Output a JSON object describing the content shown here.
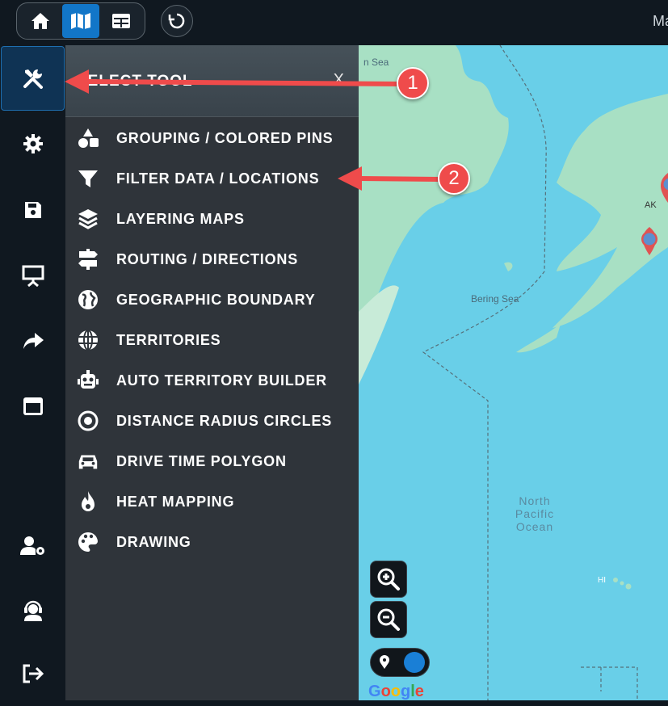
{
  "topbar": {
    "buttons": [
      {
        "name": "home",
        "icon": "home-icon",
        "active": false
      },
      {
        "name": "map",
        "icon": "map-icon",
        "active": true
      },
      {
        "name": "table",
        "icon": "table-icon",
        "active": false
      }
    ],
    "refresh_icon": "refresh-icon",
    "right_text": "Ma"
  },
  "rail": {
    "items": [
      {
        "icon": "tools-icon",
        "active": true
      },
      {
        "icon": "gear-icon"
      },
      {
        "icon": "save-icon"
      },
      {
        "icon": "presentation-icon"
      },
      {
        "icon": "share-icon"
      },
      {
        "icon": "window-icon"
      },
      {
        "icon": "user-settings-icon"
      },
      {
        "icon": "support-icon"
      },
      {
        "icon": "logout-icon"
      }
    ]
  },
  "panel": {
    "title": "SELECT TOOL",
    "close": "X",
    "tools": [
      {
        "label": "GROUPING / COLORED PINS",
        "icon": "shapes-icon"
      },
      {
        "label": "FILTER DATA / LOCATIONS",
        "icon": "filter-icon"
      },
      {
        "label": "LAYERING MAPS",
        "icon": "layers-icon"
      },
      {
        "label": "ROUTING / DIRECTIONS",
        "icon": "signpost-icon"
      },
      {
        "label": "GEOGRAPHIC BOUNDARY",
        "icon": "globe-icon"
      },
      {
        "label": "TERRITORIES",
        "icon": "grid-globe-icon"
      },
      {
        "label": "AUTO TERRITORY BUILDER",
        "icon": "robot-icon"
      },
      {
        "label": "DISTANCE RADIUS CIRCLES",
        "icon": "radius-icon"
      },
      {
        "label": "DRIVE TIME POLYGON",
        "icon": "car-icon"
      },
      {
        "label": "HEAT MAPPING",
        "icon": "flame-icon"
      },
      {
        "label": "DRAWING",
        "icon": "palette-icon"
      }
    ]
  },
  "map": {
    "labels": {
      "sea_top": "n Sea",
      "bering": "Bering Sea",
      "ak": "AK",
      "hi": "HI",
      "ocean_line1": "North",
      "ocean_line2": "Pacific",
      "ocean_line3": "Ocean"
    },
    "google": "Google",
    "colors": {
      "water": "#69cfe8",
      "land": "#a8e0c4",
      "pin": "#e05252"
    }
  },
  "annotations": {
    "badge1": "1",
    "badge2": "2"
  }
}
